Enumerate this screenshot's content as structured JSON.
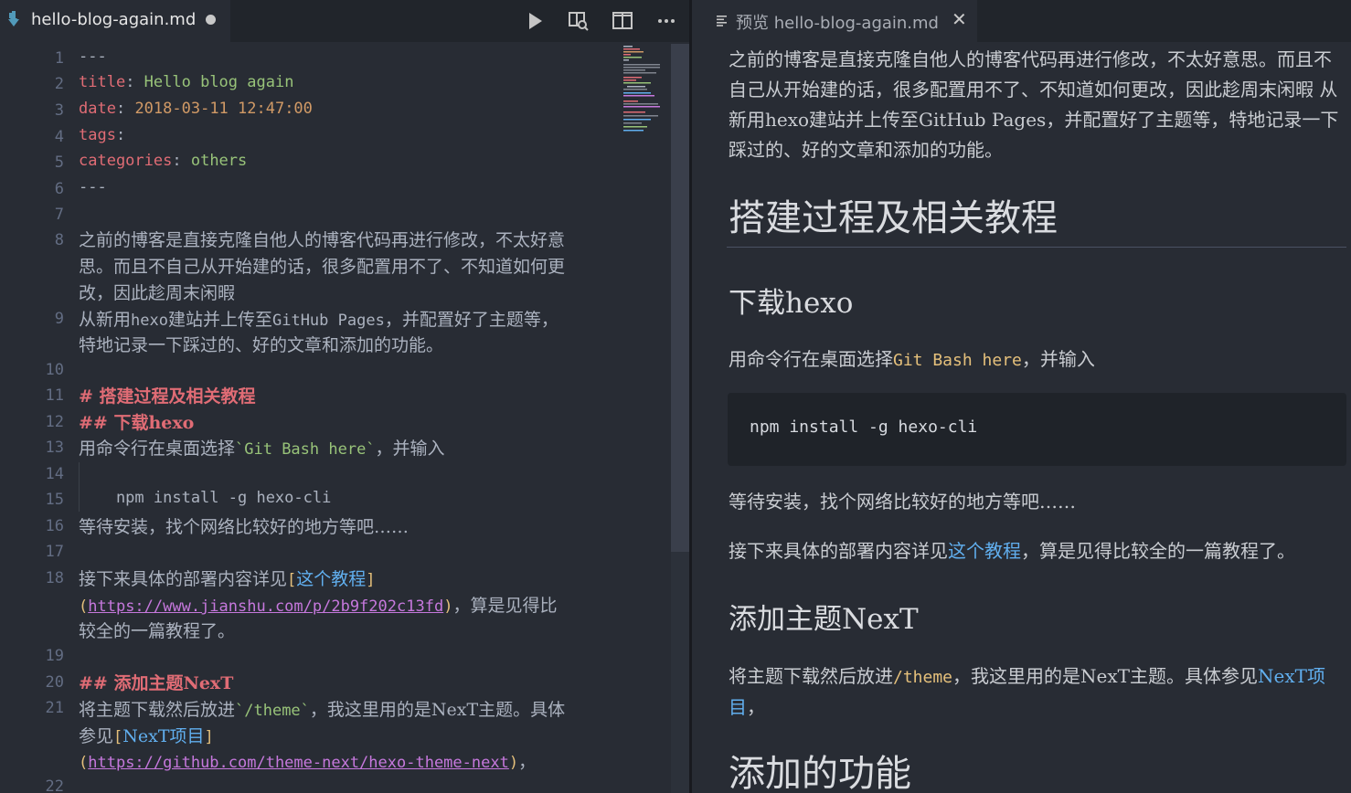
{
  "editor": {
    "tab_title": "hello-blog-again.md",
    "line_numbers": [
      "1",
      "2",
      "3",
      "4",
      "5",
      "6",
      "7",
      "8",
      "9",
      "10",
      "11",
      "12",
      "13",
      "14",
      "15",
      "16",
      "17",
      "18",
      "19",
      "20",
      "21",
      "22"
    ],
    "code": {
      "l1": "---",
      "l2_key": "title",
      "l2_colon": ": ",
      "l2_val": "Hello blog again",
      "l3_key": "date",
      "l3_colon": ": ",
      "l3_val": "2018-03-11 12:47:00",
      "l4_key": "tags",
      "l4_colon": ":",
      "l5_key": "categories",
      "l5_colon": ": ",
      "l5_val": "others",
      "l6": "---",
      "l8_a": "之前的博客是直接克隆自他人的博客代码再进行修改，不太好意",
      "l8_b": "思。而且不自己从开始建的话，很多配置用不了、不知道如何更",
      "l8_c": "改，因此趁周末闲暇",
      "l9_pre": "从新用",
      "l9_hexo": "hexo",
      "l9_mid": "建站并上传至",
      "l9_gh": "GitHub Pages",
      "l9_post": "，并配置好了主题等，",
      "l9_b": "特地记录一下踩过的、好的文章和添加的功能。",
      "l11": "# 搭建过程及相关教程",
      "l12": "## 下载hexo",
      "l13_pre": "用命令行在桌面选择",
      "l13_code": "`Git Bash here`",
      "l13_post": "，并输入",
      "l15": "    npm install -g hexo-cli",
      "l16": "等待安装，找个网络比较好的地方等吧……",
      "l18_pre": "接下来具体的部署内容详见",
      "l18_lb": "[",
      "l18_link": "这个教程",
      "l18_rb": "]",
      "l18_lp": "(",
      "l18_url": "https://www.jianshu.com/p/2b9f202c13fd",
      "l18_rp": ")",
      "l18_post": "，算是见得比",
      "l18_c": "较全的一篇教程了。",
      "l20": "## 添加主题NexT",
      "l21_pre": "将主题下载然后放进",
      "l21_code": "`/theme`",
      "l21_post": "，我这里用的是NexT主题。具体",
      "l21_b_pre": "参见",
      "l21_lb": "[",
      "l21_link": "NexT项目",
      "l21_rb": "]",
      "l21_lp": "(",
      "l21_url": "https://github.com/theme-next/hexo-theme-next",
      "l21_rp": ")",
      "l21_post2": "，"
    }
  },
  "preview": {
    "tab_title": "预览 hello-blog-again.md",
    "close_glyph": "✕",
    "para1": "之前的博客是直接克隆自他人的博客代码再进行修改，不太好意思。而且不自己从开始建的话，很多配置用不了、不知道如何更改，因此趁周末闲暇 从新用hexo建站并上传至GitHub Pages，并配置好了主题等，特地记录一下踩过的、好的文章和添加的功能。",
    "h1_setup": "搭建过程及相关教程",
    "h2_download": "下载hexo",
    "para2_pre": "用命令行在桌面选择",
    "para2_code": "Git Bash here",
    "para2_post": "，并输入",
    "code_block": "npm install -g hexo-cli",
    "para3": "等待安装，找个网络比较好的地方等吧……",
    "para4_pre": "接下来具体的部署内容详见",
    "para4_link": "这个教程",
    "para4_post": "，算是见得比较全的一篇教程了。",
    "h2_theme": "添加主题NexT",
    "para5_pre": "将主题下载然后放进",
    "para5_code": "/theme",
    "para5_mid": "，我这里用的是NexT主题。具体参见",
    "para5_link": "NexT项目",
    "para5_post": "，",
    "h1_features": "添加的功能"
  },
  "colors": {
    "background": "#282c34",
    "tabbar": "#21252b",
    "key": "#e06c75",
    "string": "#98c379",
    "number": "#d19a66",
    "link": "#61afef",
    "url": "#c678dd",
    "inline_code": "#e5c07b"
  },
  "icons": [
    "markdown-file-icon",
    "run-icon",
    "open-preview-icon",
    "split-editor-icon",
    "more-actions-icon",
    "preview-doc-icon",
    "close-icon"
  ]
}
